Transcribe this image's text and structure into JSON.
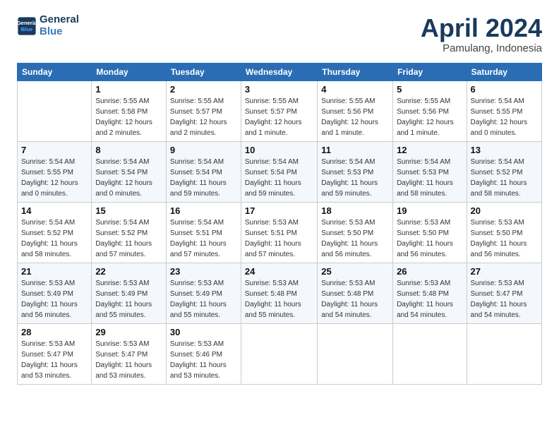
{
  "header": {
    "logo_line1": "General",
    "logo_line2": "Blue",
    "month": "April 2024",
    "location": "Pamulang, Indonesia"
  },
  "days_of_week": [
    "Sunday",
    "Monday",
    "Tuesday",
    "Wednesday",
    "Thursday",
    "Friday",
    "Saturday"
  ],
  "weeks": [
    [
      {
        "day": "",
        "info": ""
      },
      {
        "day": "1",
        "info": "Sunrise: 5:55 AM\nSunset: 5:58 PM\nDaylight: 12 hours\nand 2 minutes."
      },
      {
        "day": "2",
        "info": "Sunrise: 5:55 AM\nSunset: 5:57 PM\nDaylight: 12 hours\nand 2 minutes."
      },
      {
        "day": "3",
        "info": "Sunrise: 5:55 AM\nSunset: 5:57 PM\nDaylight: 12 hours\nand 1 minute."
      },
      {
        "day": "4",
        "info": "Sunrise: 5:55 AM\nSunset: 5:56 PM\nDaylight: 12 hours\nand 1 minute."
      },
      {
        "day": "5",
        "info": "Sunrise: 5:55 AM\nSunset: 5:56 PM\nDaylight: 12 hours\nand 1 minute."
      },
      {
        "day": "6",
        "info": "Sunrise: 5:54 AM\nSunset: 5:55 PM\nDaylight: 12 hours\nand 0 minutes."
      }
    ],
    [
      {
        "day": "7",
        "info": "Sunrise: 5:54 AM\nSunset: 5:55 PM\nDaylight: 12 hours\nand 0 minutes."
      },
      {
        "day": "8",
        "info": "Sunrise: 5:54 AM\nSunset: 5:54 PM\nDaylight: 12 hours\nand 0 minutes."
      },
      {
        "day": "9",
        "info": "Sunrise: 5:54 AM\nSunset: 5:54 PM\nDaylight: 11 hours\nand 59 minutes."
      },
      {
        "day": "10",
        "info": "Sunrise: 5:54 AM\nSunset: 5:54 PM\nDaylight: 11 hours\nand 59 minutes."
      },
      {
        "day": "11",
        "info": "Sunrise: 5:54 AM\nSunset: 5:53 PM\nDaylight: 11 hours\nand 59 minutes."
      },
      {
        "day": "12",
        "info": "Sunrise: 5:54 AM\nSunset: 5:53 PM\nDaylight: 11 hours\nand 58 minutes."
      },
      {
        "day": "13",
        "info": "Sunrise: 5:54 AM\nSunset: 5:52 PM\nDaylight: 11 hours\nand 58 minutes."
      }
    ],
    [
      {
        "day": "14",
        "info": "Sunrise: 5:54 AM\nSunset: 5:52 PM\nDaylight: 11 hours\nand 58 minutes."
      },
      {
        "day": "15",
        "info": "Sunrise: 5:54 AM\nSunset: 5:52 PM\nDaylight: 11 hours\nand 57 minutes."
      },
      {
        "day": "16",
        "info": "Sunrise: 5:54 AM\nSunset: 5:51 PM\nDaylight: 11 hours\nand 57 minutes."
      },
      {
        "day": "17",
        "info": "Sunrise: 5:53 AM\nSunset: 5:51 PM\nDaylight: 11 hours\nand 57 minutes."
      },
      {
        "day": "18",
        "info": "Sunrise: 5:53 AM\nSunset: 5:50 PM\nDaylight: 11 hours\nand 56 minutes."
      },
      {
        "day": "19",
        "info": "Sunrise: 5:53 AM\nSunset: 5:50 PM\nDaylight: 11 hours\nand 56 minutes."
      },
      {
        "day": "20",
        "info": "Sunrise: 5:53 AM\nSunset: 5:50 PM\nDaylight: 11 hours\nand 56 minutes."
      }
    ],
    [
      {
        "day": "21",
        "info": "Sunrise: 5:53 AM\nSunset: 5:49 PM\nDaylight: 11 hours\nand 56 minutes."
      },
      {
        "day": "22",
        "info": "Sunrise: 5:53 AM\nSunset: 5:49 PM\nDaylight: 11 hours\nand 55 minutes."
      },
      {
        "day": "23",
        "info": "Sunrise: 5:53 AM\nSunset: 5:49 PM\nDaylight: 11 hours\nand 55 minutes."
      },
      {
        "day": "24",
        "info": "Sunrise: 5:53 AM\nSunset: 5:48 PM\nDaylight: 11 hours\nand 55 minutes."
      },
      {
        "day": "25",
        "info": "Sunrise: 5:53 AM\nSunset: 5:48 PM\nDaylight: 11 hours\nand 54 minutes."
      },
      {
        "day": "26",
        "info": "Sunrise: 5:53 AM\nSunset: 5:48 PM\nDaylight: 11 hours\nand 54 minutes."
      },
      {
        "day": "27",
        "info": "Sunrise: 5:53 AM\nSunset: 5:47 PM\nDaylight: 11 hours\nand 54 minutes."
      }
    ],
    [
      {
        "day": "28",
        "info": "Sunrise: 5:53 AM\nSunset: 5:47 PM\nDaylight: 11 hours\nand 53 minutes."
      },
      {
        "day": "29",
        "info": "Sunrise: 5:53 AM\nSunset: 5:47 PM\nDaylight: 11 hours\nand 53 minutes."
      },
      {
        "day": "30",
        "info": "Sunrise: 5:53 AM\nSunset: 5:46 PM\nDaylight: 11 hours\nand 53 minutes."
      },
      {
        "day": "",
        "info": ""
      },
      {
        "day": "",
        "info": ""
      },
      {
        "day": "",
        "info": ""
      },
      {
        "day": "",
        "info": ""
      }
    ]
  ]
}
